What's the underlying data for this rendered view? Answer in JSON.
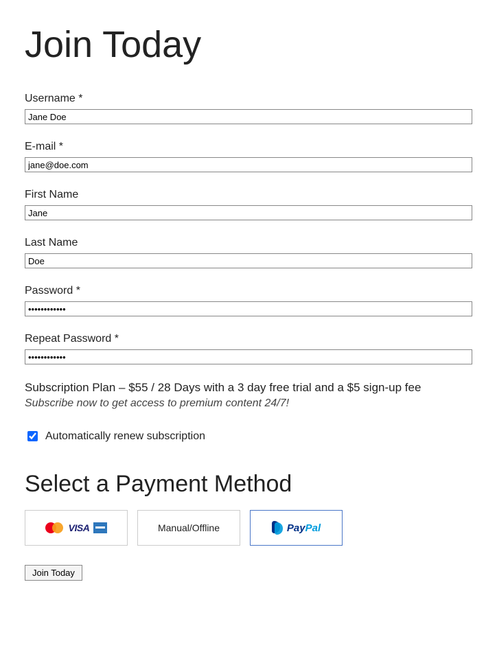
{
  "page_title": "Join Today",
  "fields": {
    "username": {
      "label": "Username *",
      "value": "Jane Doe"
    },
    "email": {
      "label": "E-mail *",
      "value": "jane@doe.com"
    },
    "first_name": {
      "label": "First Name",
      "value": "Jane"
    },
    "last_name": {
      "label": "Last Name",
      "value": "Doe"
    },
    "password": {
      "label": "Password *",
      "value": "••••••••••••"
    },
    "repeat_password": {
      "label": "Repeat Password *",
      "value": "••••••••••••"
    }
  },
  "plan": {
    "text": "Subscription Plan – $55 / 28 Days with a 3 day free trial and a $5 sign-up fee",
    "subtitle": "Subscribe now to get access to premium content 24/7!"
  },
  "auto_renew": {
    "label": "Automatically renew subscription",
    "checked": true
  },
  "payment_section_title": "Select a Payment Method",
  "payment_methods": {
    "cards_visa_label": "VISA",
    "manual_label": "Manual/Offline",
    "paypal_pay": "Pay",
    "paypal_pal": "Pal"
  },
  "submit_label": "Join Today"
}
